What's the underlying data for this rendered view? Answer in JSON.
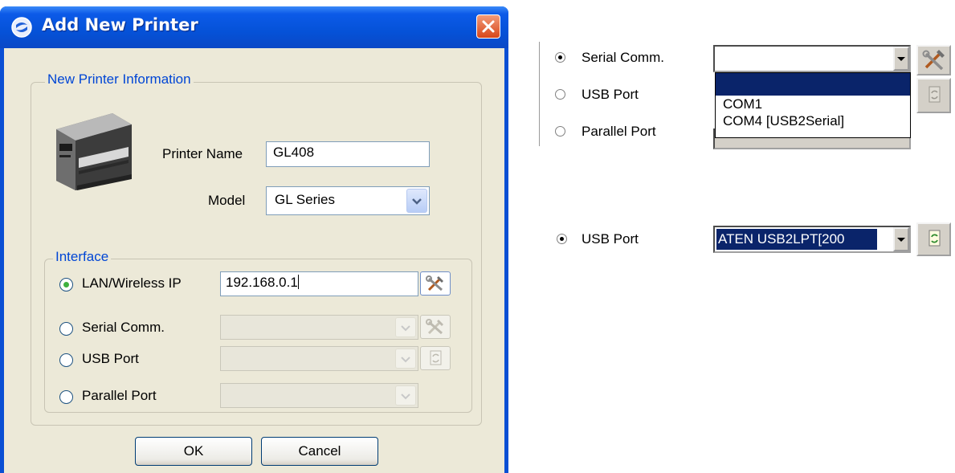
{
  "dialog": {
    "title": "Add New Printer",
    "printer_info": {
      "legend": "New Printer Information",
      "printer_name_label": "Printer Name",
      "printer_name_value": "GL408",
      "model_label": "Model",
      "model_value": "GL Series"
    },
    "interface": {
      "legend": "Interface",
      "options": [
        {
          "label": "LAN/Wireless IP",
          "value": "192.168.0.1",
          "selected": true
        },
        {
          "label": "Serial Comm.",
          "value": "",
          "selected": false
        },
        {
          "label": "USB Port",
          "value": "",
          "selected": false
        },
        {
          "label": "Parallel Port",
          "value": "",
          "selected": false
        }
      ]
    },
    "ok_label": "OK",
    "cancel_label": "Cancel"
  },
  "serial_panel": {
    "options": [
      {
        "label": "Serial Comm.",
        "selected": true
      },
      {
        "label": "USB Port",
        "selected": false
      },
      {
        "label": "Parallel Port",
        "selected": false
      }
    ],
    "dropdown_items": [
      "",
      "COM1",
      "COM4 [USB2Serial]"
    ]
  },
  "usb_panel": {
    "label": "USB Port",
    "value": "ATEN USB2LPT[200"
  },
  "colors": {
    "title_bar": "#0552d8",
    "dialog_face": "#ece9d8",
    "legend_text": "#0046d5",
    "selection": "#0a246a"
  }
}
